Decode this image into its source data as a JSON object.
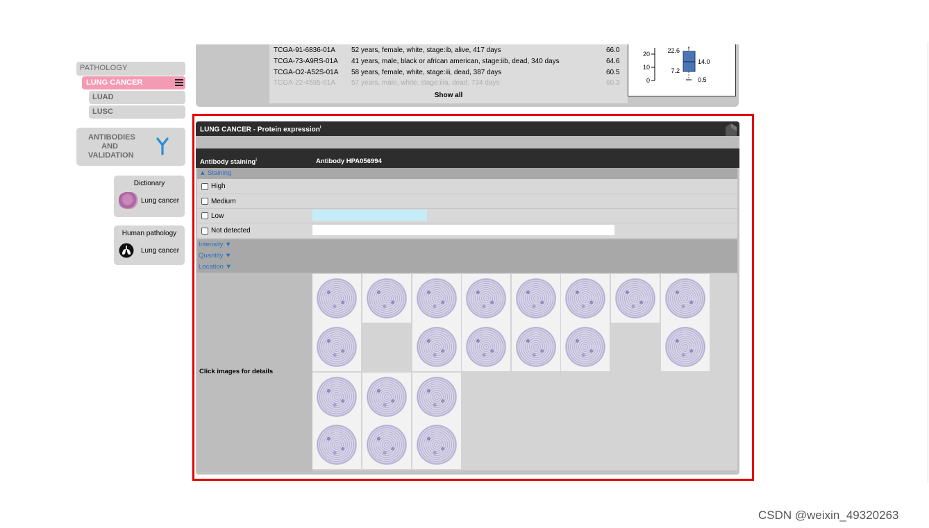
{
  "sidebar": {
    "header": "PATHOLOGY",
    "active_item": "LUNG CANCER",
    "sub_items": [
      "LUAD",
      "LUSC"
    ],
    "antibodies_label_lines": [
      "ANTIBODIES",
      "AND",
      "VALIDATION"
    ],
    "dictionary": {
      "title": "Dictionary",
      "link": "Lung cancer"
    },
    "human_pathology": {
      "title": "Human pathology",
      "link": "Lung cancer"
    }
  },
  "top_table": {
    "rows": [
      {
        "id": "TCGA-91-6836-01A",
        "desc": "52 years, female, white, stage:ib, alive, 417 days",
        "value": "66.0"
      },
      {
        "id": "TCGA-73-A9RS-01A",
        "desc": "41 years, male, black or african american, stage:iib, dead, 340 days",
        "value": "64.6"
      },
      {
        "id": "TCGA-O2-A52S-01A",
        "desc": "58 years, female, white, stage:iii, dead, 387 days",
        "value": "60.5"
      },
      {
        "id": "TCGA-22-4595-01A",
        "desc": "57 years, male, white, stage:iiia, dead, 734 days",
        "value": "60.3"
      }
    ],
    "show_all": "Show all",
    "boxplot": {
      "y_ticks": [
        "20",
        "10",
        "0"
      ],
      "labels": {
        "upper": "22.6",
        "median": "14.0",
        "lower": "7.2",
        "min": "0.5"
      }
    }
  },
  "main_panel": {
    "title": "LUNG CANCER - Protein expression",
    "title_sup": "i",
    "column_header_left": "Antibody staining",
    "column_header_left_sup": "i",
    "column_header_right": "Antibody HPA056994",
    "staining_section": "▲ Staining",
    "levels": [
      {
        "label": "High",
        "bar_fraction": 0
      },
      {
        "label": "Medium",
        "bar_fraction": 0
      },
      {
        "label": "Low",
        "bar_fraction": 0.27
      },
      {
        "label": "Not detected",
        "bar_fraction": 0.71
      }
    ],
    "collapsed_sections": [
      "Intensity ▼",
      "Quantity ▼",
      "Location ▼"
    ],
    "images_label": "Click images for details"
  },
  "colors": {
    "active_pink": "#f49bb4",
    "low_bar": "#c6ecf8",
    "not_detected_bar": "#ffffff",
    "highlight_frame": "#e00000",
    "section_link": "#2a72c4",
    "antibody_icon": "#2a8fd6",
    "boxplot_fill": "#4a77b4"
  },
  "watermark": "CSDN @weixin_49320263"
}
